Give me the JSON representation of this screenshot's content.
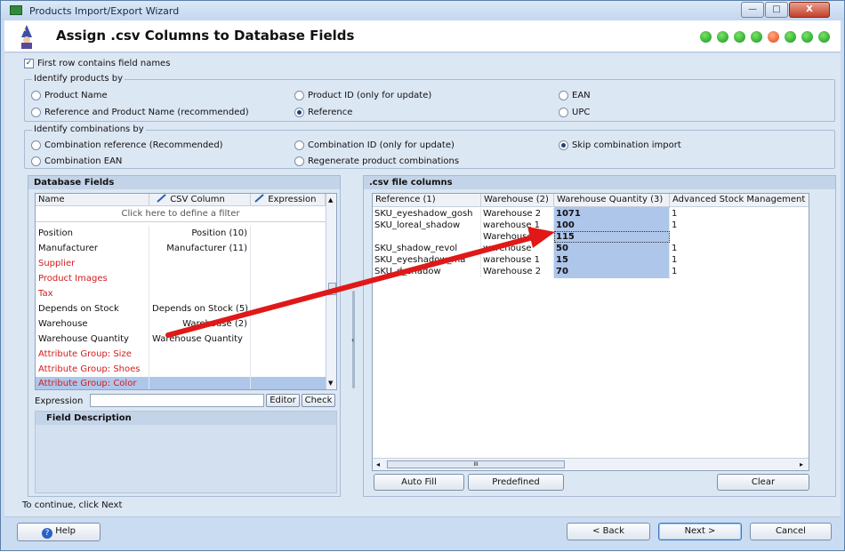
{
  "window": {
    "title": "Products Import/Export Wizard",
    "controls": [
      "—",
      "□",
      "X"
    ]
  },
  "header": {
    "title": "Assign .csv Columns to Database Fields",
    "step_count": 8,
    "active_step": 5
  },
  "first_row_checkbox": {
    "label": "First row contains field names",
    "checked": true
  },
  "identify_products": {
    "label": "Identify products by",
    "options": [
      {
        "label": "Product Name",
        "checked": false
      },
      {
        "label": "Product ID (only for update)",
        "checked": false
      },
      {
        "label": "EAN",
        "checked": false
      },
      {
        "label": "Reference and Product Name (recommended)",
        "checked": false
      },
      {
        "label": "Reference",
        "checked": true
      },
      {
        "label": "UPC",
        "checked": false
      }
    ]
  },
  "identify_combinations": {
    "label": "Identify combinations by",
    "options": [
      {
        "label": "Combination reference (Recommended)",
        "checked": false
      },
      {
        "label": "Combination ID (only for update)",
        "checked": false
      },
      {
        "label": "Skip combination import",
        "checked": true
      },
      {
        "label": "Combination EAN",
        "checked": false
      },
      {
        "label": "Regenerate product combinations",
        "checked": false
      }
    ]
  },
  "db_fields": {
    "title": "Database Fields",
    "columns": [
      "Name",
      "CSV Column",
      "Expression"
    ],
    "filter_text": "Click here to define a filter",
    "rows": [
      {
        "name": "Position",
        "csv": "Position (10)",
        "required": false
      },
      {
        "name": "Manufacturer",
        "csv": "Manufacturer (11)",
        "required": false
      },
      {
        "name": "Supplier",
        "csv": "",
        "required": true
      },
      {
        "name": "Product Images",
        "csv": "",
        "required": true
      },
      {
        "name": "Tax",
        "csv": "",
        "required": true
      },
      {
        "name": "Depends on Stock",
        "csv": "Depends on Stock (5)",
        "required": false
      },
      {
        "name": "Warehouse",
        "csv": "Warehouse (2)",
        "required": false
      },
      {
        "name": "Warehouse Quantity",
        "csv": "Warehouse Quantity",
        "required": false
      },
      {
        "name": "Attribute Group: Size",
        "csv": "",
        "required": true
      },
      {
        "name": "Attribute Group: Shoes",
        "csv": "",
        "required": true
      },
      {
        "name": "Attribute Group: Color",
        "csv": "",
        "required": true
      }
    ],
    "expression_label": "Expression",
    "expression_value": "",
    "editor_button": "Editor",
    "check_button": "Check",
    "field_description_label": "Field Description"
  },
  "csv_columns": {
    "title": ".csv file columns",
    "columns": [
      "Reference (1)",
      "Warehouse (2)",
      "Warehouse Quantity (3)",
      "Advanced Stock Management"
    ],
    "rows": [
      [
        "SKU_eyeshadow_gosh",
        "Warehouse 2",
        "1071",
        "1"
      ],
      [
        "SKU_loreal_shadow",
        "warehouse 1",
        "100",
        "1"
      ],
      [
        "",
        "Warehouse",
        "115",
        ""
      ],
      [
        "SKU_shadow_revol",
        "warehouse",
        "50",
        "1"
      ],
      [
        "SKU_eyeshadow_ma",
        "warehouse 1",
        "15",
        "1"
      ],
      [
        "SKU_d_shadow",
        "Warehouse 2",
        "70",
        "1"
      ]
    ],
    "hscroll_glyph": "III",
    "auto_fill_button": "Auto Fill",
    "predefined_button": "Predefined",
    "clear_button": "Clear"
  },
  "footer": {
    "hint": "To continue, click Next",
    "help_button": "Help",
    "back_button": "< Back",
    "next_button": "Next >",
    "cancel_button": "Cancel"
  },
  "colors": {
    "required_field": "#d41c1c",
    "selection": "#aec6ea",
    "arrow": "#e01818"
  }
}
